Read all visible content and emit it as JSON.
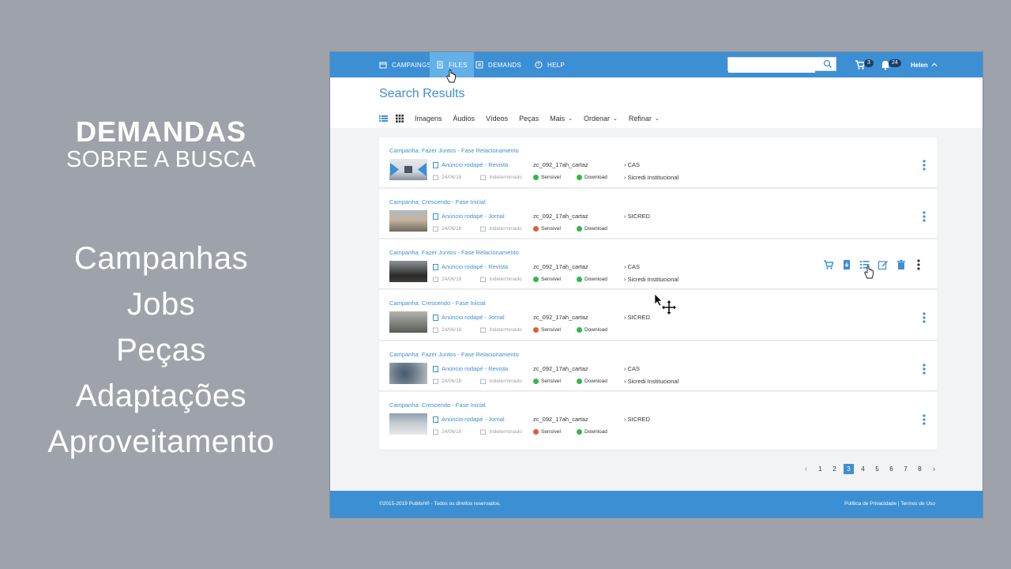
{
  "slide": {
    "title": "DEMANDAS",
    "subtitle": "SOBRE A BUSCA",
    "topics": [
      "Campanhas",
      "Jobs",
      "Peças",
      "Adaptações",
      "Aproveitamento"
    ]
  },
  "nav": {
    "items": [
      {
        "label": "CAMPAINGS",
        "icon": "calendar-icon"
      },
      {
        "label": "FILES",
        "icon": "file-icon",
        "active": true
      },
      {
        "label": "DEMANDS",
        "icon": "list-icon"
      },
      {
        "label": "HELP",
        "icon": "help-icon"
      }
    ],
    "search_placeholder": "",
    "cart_count": "3",
    "notification_count": "24",
    "user_name": "Helen"
  },
  "page": {
    "title": "Search Results",
    "filters": [
      "Imagens",
      "Áudios",
      "Vídeos",
      "Peças",
      "Mais",
      "Ordenar",
      "Refinar"
    ]
  },
  "results": [
    {
      "campaign": "Campanha: Fazer Juntos - Fase Relacionamento",
      "piece": "Anúncio rodapé - Revista",
      "date": "24/06/18",
      "period": "Indeterminado",
      "code": "zc_092_17ah_cartaz",
      "sensitive": "Sensível",
      "sensitive_status": "ok",
      "download": "Download",
      "tag1": "CAS",
      "tag2": "Sicredi Institucional"
    },
    {
      "campaign": "Campanha: Crescendo - Fase Inicial",
      "piece": "Anúncio rodapé - Jornal",
      "date": "24/06/18",
      "period": "Indeterminado",
      "code": "zc_092_17ah_cartaz",
      "sensitive": "Sensível",
      "sensitive_status": "no",
      "download": "Download",
      "tag1": "SICRED",
      "tag2": ""
    },
    {
      "campaign": "Campanha: Fazer Juntos - Fase Relacionamento",
      "piece": "Anúncio rodapé - Revista",
      "date": "24/06/18",
      "period": "Indeterminado",
      "code": "zc_092_17ah_cartaz",
      "sensitive": "Sensível",
      "sensitive_status": "ok",
      "download": "Download",
      "tag1": "CAS",
      "tag2": "Sicredi Institucional"
    },
    {
      "campaign": "Campanha: Crescendo - Fase Inicial",
      "piece": "Anúncio rodapé - Jornal",
      "date": "24/06/18",
      "period": "Indeterminado",
      "code": "zc_092_17ah_cartaz",
      "sensitive": "Sensível",
      "sensitive_status": "no",
      "download": "Download",
      "tag1": "SICRED",
      "tag2": ""
    },
    {
      "campaign": "Campanha: Fazer Juntos - Fase Relacionamento",
      "piece": "Anúncio rodapé - Revista",
      "date": "24/06/18",
      "period": "Indeterminado",
      "code": "zc_092_17ah_cartaz",
      "sensitive": "Sensível",
      "sensitive_status": "ok",
      "download": "Download",
      "tag1": "CAS",
      "tag2": "Sicredi Institucional"
    },
    {
      "campaign": "Campanha: Crescendo - Fase Inicial",
      "piece": "Anúncio rodapé - Jornal",
      "date": "24/06/18",
      "period": "Indeterminado",
      "code": "zc_092_17ah_cartaz",
      "sensitive": "Sensível",
      "sensitive_status": "no",
      "download": "Download",
      "tag1": "SICRED",
      "tag2": ""
    }
  ],
  "pagination": {
    "pages": [
      "1",
      "2",
      "3",
      "4",
      "5",
      "6",
      "7",
      "8"
    ],
    "current": "3"
  },
  "footer": {
    "copyright": "©2015-2019 Publish® - Todos os direitos reservados.",
    "links": "Política de Privacidade | Termos de Uso"
  },
  "colors": {
    "primary": "#3d8fd4",
    "ok": "#36b54a",
    "no": "#e25c39"
  }
}
